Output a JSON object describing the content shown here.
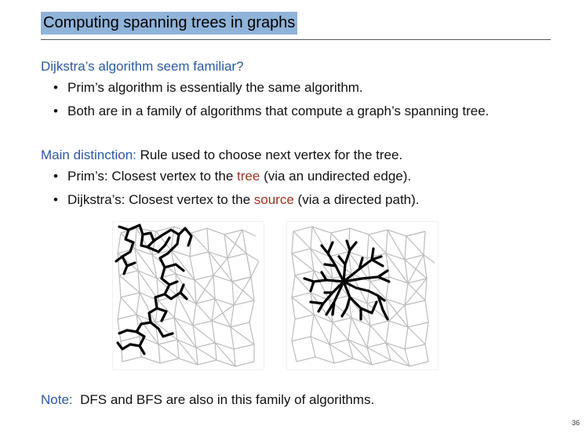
{
  "slide": {
    "title": "Computing spanning trees in graphs",
    "section1": {
      "heading": "Dijkstra’s algorithm seem familiar?",
      "bullets": [
        "Prim’s algorithm is essentially the same algorithm.",
        "Both are in a family of algorithms that compute a graph’s spanning tree."
      ]
    },
    "section2": {
      "heading": "Main distinction:",
      "heading_rest": " Rule used to choose next vertex for the tree.",
      "bullet1": {
        "prefix": "Prim’s: Closest vertex to the ",
        "highlight": "tree",
        "suffix": " (via an undirected edge)."
      },
      "bullet2": {
        "prefix": "Dijkstra’s: Closest vertex to the ",
        "highlight": "source",
        "suffix": " (via a directed path)."
      }
    },
    "figures": [
      {
        "name": "prim-spanning-tree"
      },
      {
        "name": "dijkstra-shortest-path-tree"
      }
    ],
    "note": {
      "label": "Note:",
      "text": "DFS and BFS are also in this family of algorithms."
    },
    "page_number": "36",
    "colors": {
      "title_bg": "#8fb3d9",
      "heading": "#2b5aa3",
      "highlight": "#a43220",
      "graph_edges": "#bcbcbc",
      "tree_edges": "#000000"
    }
  }
}
